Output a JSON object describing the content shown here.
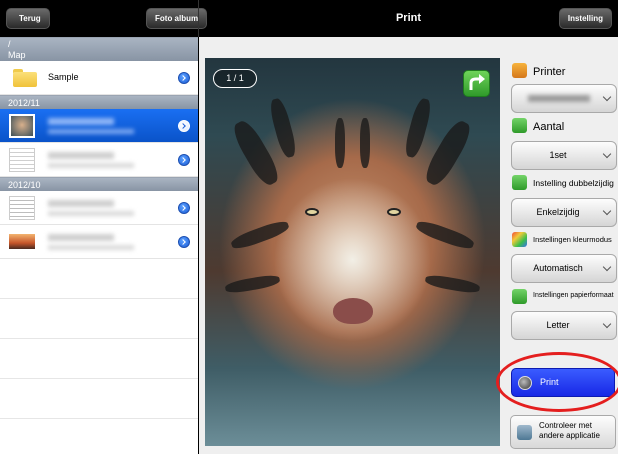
{
  "topbar": {
    "back_label": "Terug",
    "album_label": "Foto album",
    "title": "Print",
    "settings_label": "Instelling"
  },
  "left": {
    "path": "/",
    "folder_header": "Map",
    "folder_item": "Sample",
    "group1_header": "2012/11",
    "group2_header": "2012/10"
  },
  "preview": {
    "page_indicator": "1 / 1"
  },
  "settings": {
    "printer_label": "Printer",
    "copies_label": "Aantal",
    "copies_value": "1set",
    "duplex_label": "Instelling dubbelzijdig",
    "duplex_value": "Enkelzijdig",
    "color_label": "Instellingen kleurmodus",
    "color_value": "Automatisch",
    "paper_label": "Instellingen papierformaat",
    "paper_value": "Letter",
    "print_label": "Print",
    "open_other_label": "Controleer met andere applicatie"
  },
  "colors": {
    "selection": "#0a53c9",
    "print_button": "#1828e6",
    "highlight": "#e41e1e"
  }
}
